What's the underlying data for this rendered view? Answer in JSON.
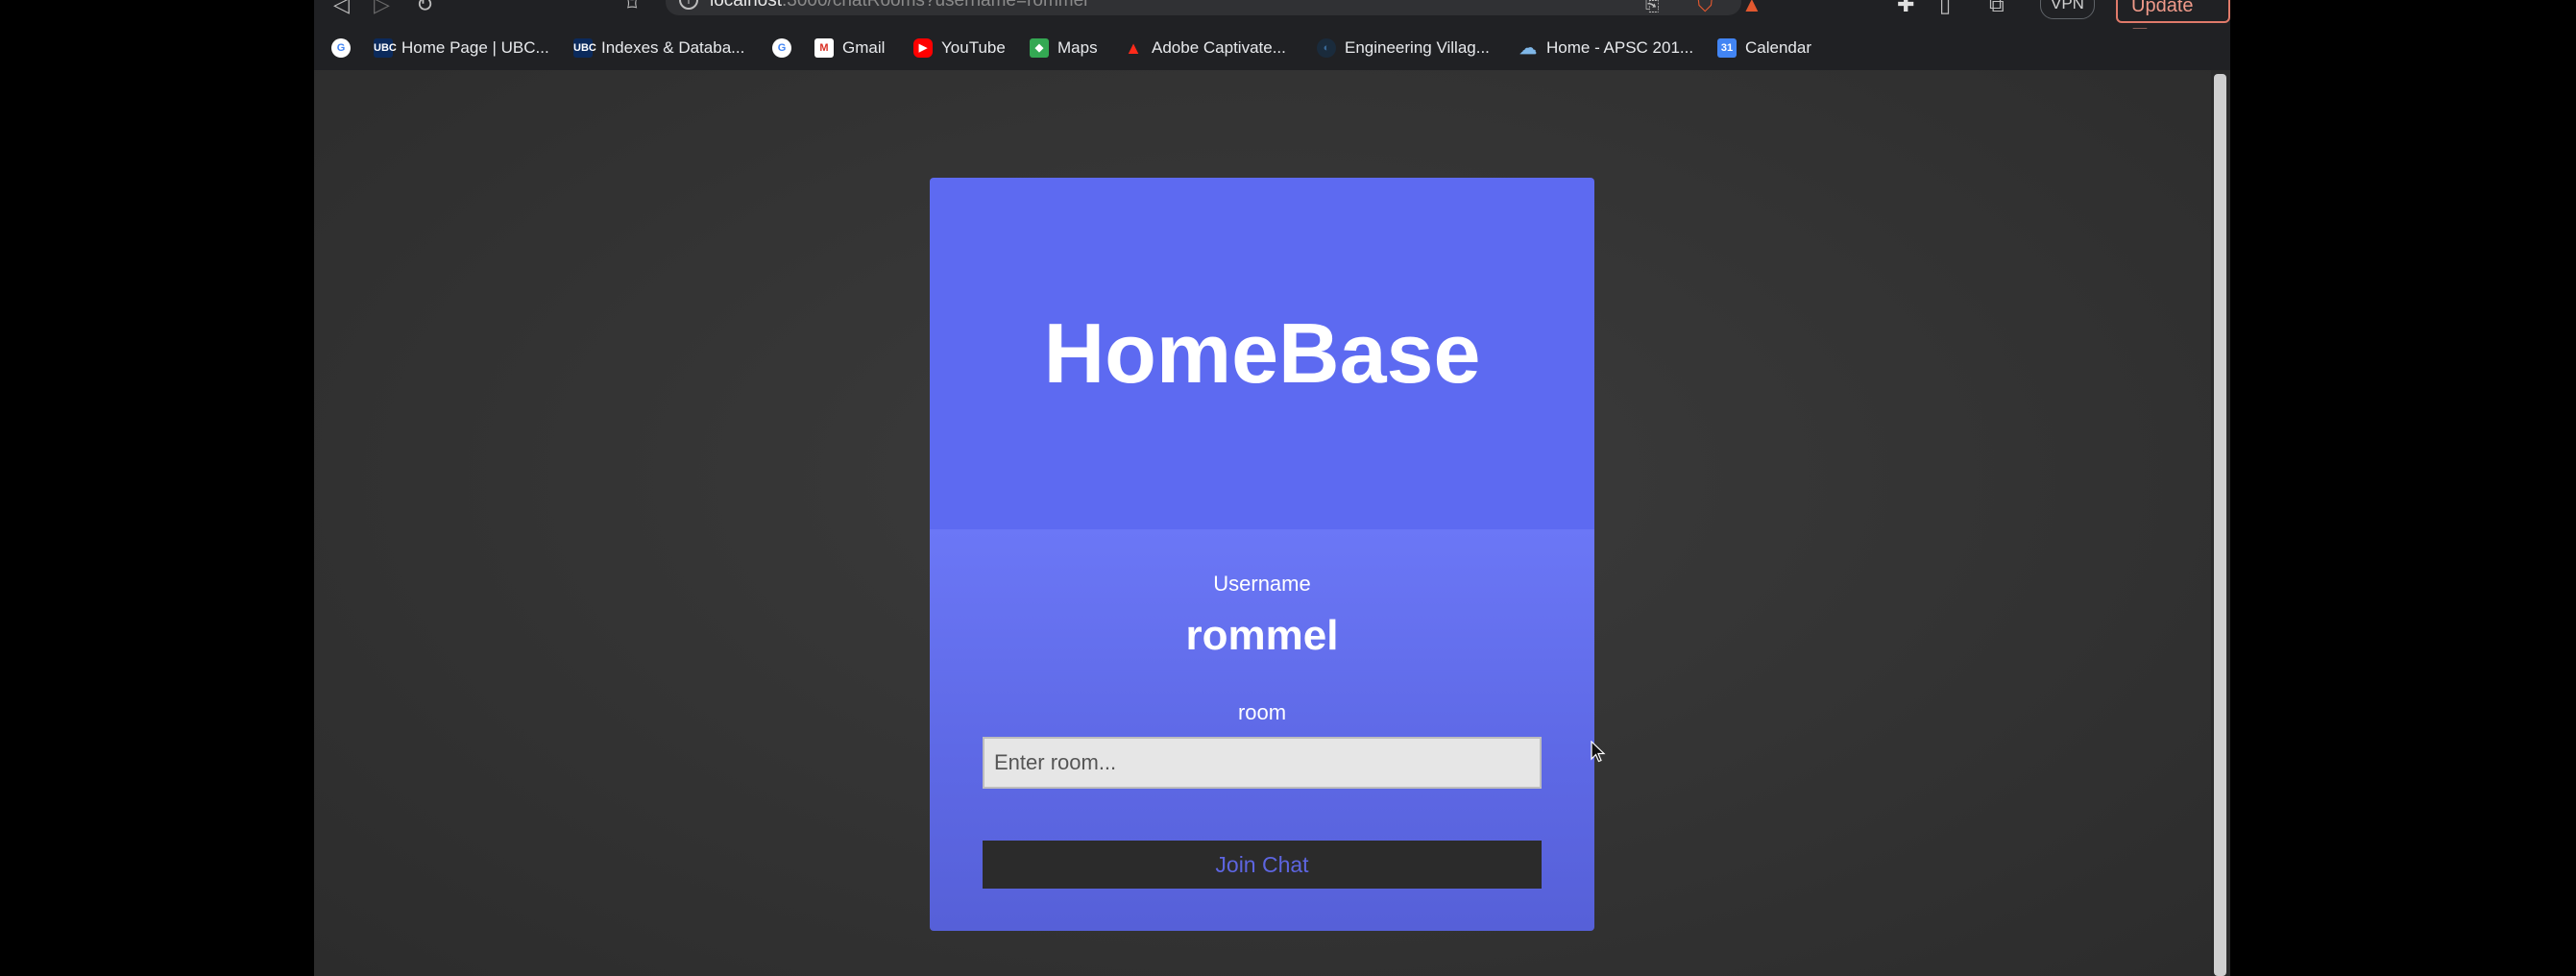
{
  "browser": {
    "url_host": "localhost",
    "url_rest": ":3000/chatRooms?username=rommel",
    "vpn_label": "VPN",
    "update_label": "Update",
    "bookmarks": [
      {
        "label": "",
        "icon": "google-icon"
      },
      {
        "label": "Home Page | UBC...",
        "icon": "ubc-icon"
      },
      {
        "label": "Indexes & Databa...",
        "icon": "ubc-icon"
      },
      {
        "label": "",
        "icon": "google-icon"
      },
      {
        "label": "Gmail",
        "icon": "gmail-icon"
      },
      {
        "label": "YouTube",
        "icon": "youtube-icon"
      },
      {
        "label": "Maps",
        "icon": "maps-icon"
      },
      {
        "label": "Adobe Captivate...",
        "icon": "adobe-icon"
      },
      {
        "label": "Engineering Villag...",
        "icon": "engineering-village-icon"
      },
      {
        "label": "Home - APSC 201...",
        "icon": "cloud-icon"
      },
      {
        "label": "Calendar",
        "icon": "calendar-icon"
      }
    ]
  },
  "app": {
    "title": "HomeBase",
    "username_label": "Username",
    "username_value": "rommel",
    "room_label": "room",
    "room_placeholder": "Enter room...",
    "room_value": "",
    "join_label": "Join Chat",
    "colors": {
      "header": "#5d6af1",
      "body": "#6b77f6",
      "button_bg": "#2b2b2b",
      "button_text": "#5d65e0"
    }
  }
}
